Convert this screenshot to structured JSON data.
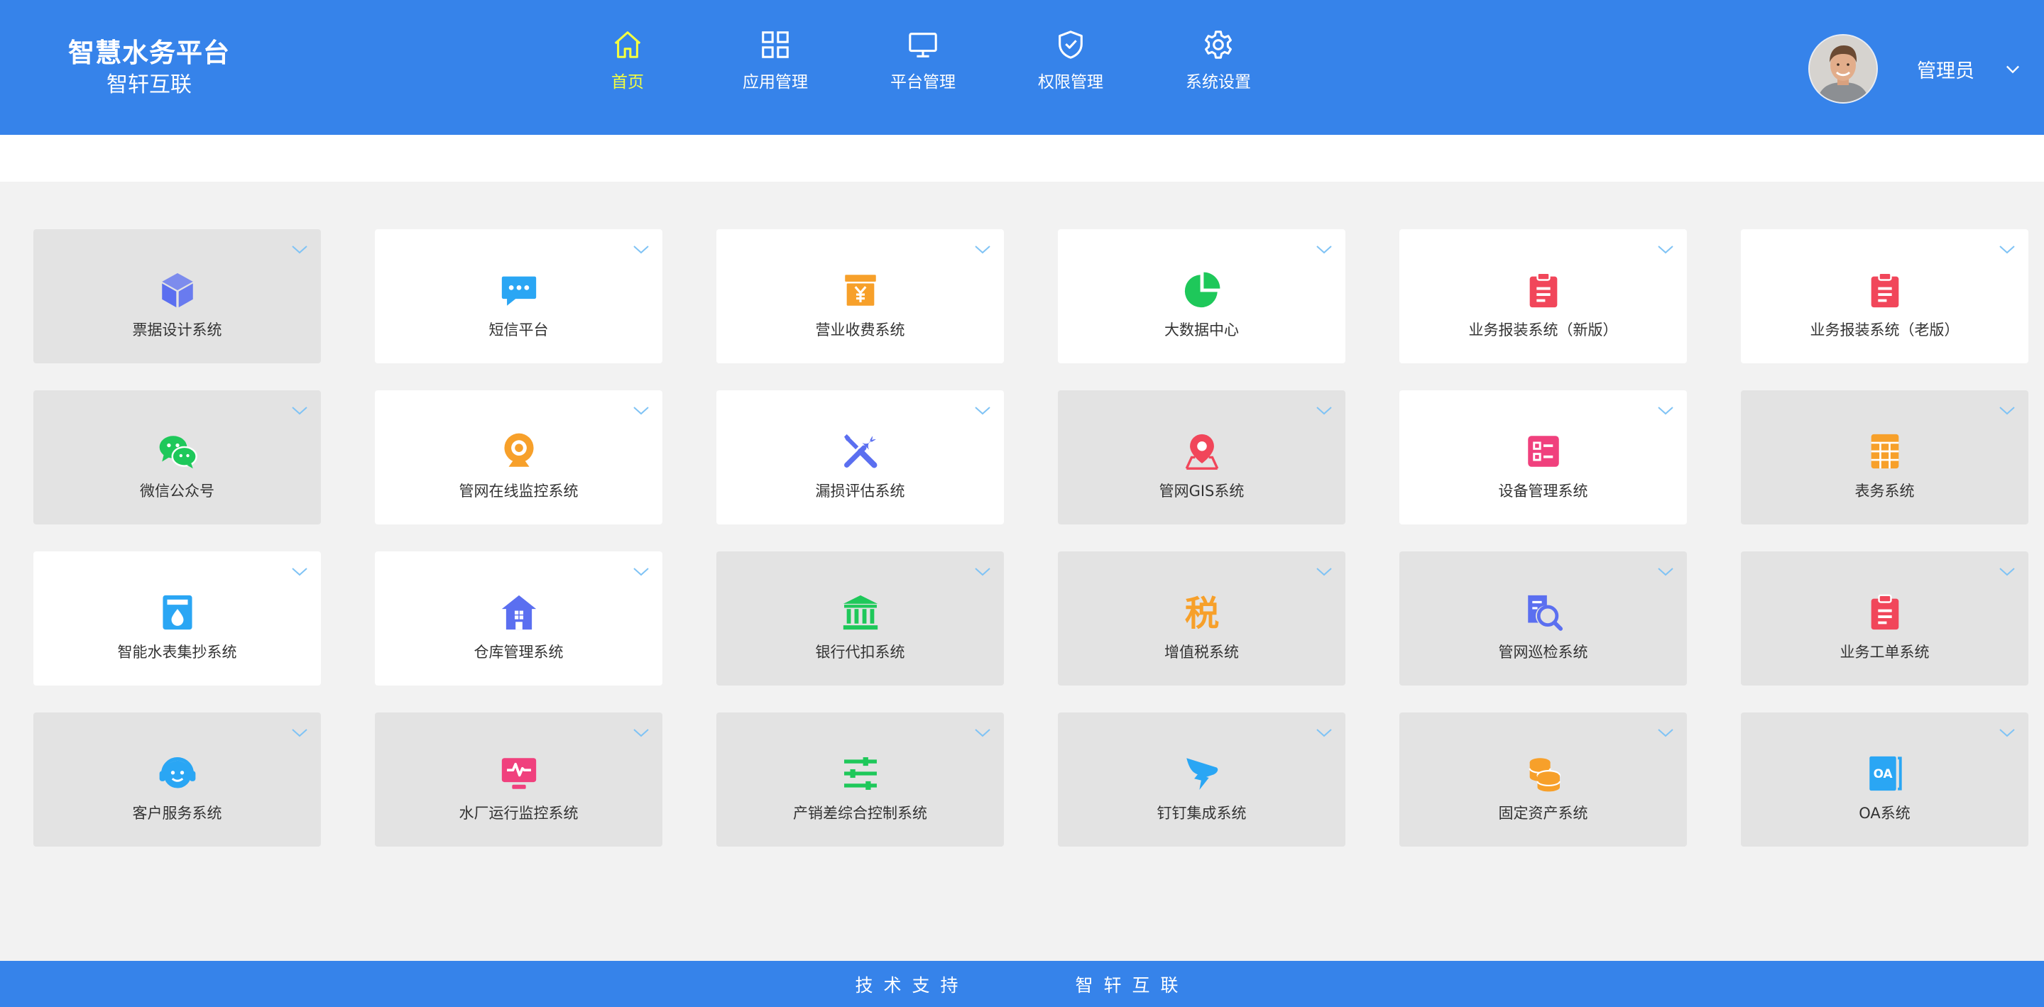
{
  "brand": {
    "title": "智慧水务平台",
    "subtitle": "智轩互联"
  },
  "nav": [
    {
      "label": "首页",
      "icon": "home-icon",
      "active": true
    },
    {
      "label": "应用管理",
      "icon": "grid-icon",
      "active": false
    },
    {
      "label": "平台管理",
      "icon": "monitor-icon",
      "active": false
    },
    {
      "label": "权限管理",
      "icon": "shield-check-icon",
      "active": false
    },
    {
      "label": "系统设置",
      "icon": "gear-icon",
      "active": false
    }
  ],
  "user": {
    "name": "管理员"
  },
  "apps": [
    {
      "label": "票据设计系统",
      "icon": "cube-icon",
      "color": "#5b6ff0",
      "bg": "grey"
    },
    {
      "label": "短信平台",
      "icon": "chat-bubble-icon",
      "color": "#2aa6f4",
      "bg": "white"
    },
    {
      "label": "营业收费系统",
      "icon": "yuan-box-icon",
      "color": "#f7a02a",
      "bg": "white"
    },
    {
      "label": "大数据中心",
      "icon": "pie-chart-icon",
      "color": "#1ec85a",
      "bg": "white"
    },
    {
      "label": "业务报装系统（新版）",
      "icon": "clipboard-icon",
      "color": "#f1465a",
      "bg": "white"
    },
    {
      "label": "业务报装系统（老版）",
      "icon": "clipboard-icon",
      "color": "#f1465a",
      "bg": "white"
    },
    {
      "label": "微信公众号",
      "icon": "wechat-icon",
      "color": "#1ec85a",
      "bg": "grey"
    },
    {
      "label": "管网在线监控系统",
      "icon": "webcam-icon",
      "color": "#f7a02a",
      "bg": "white"
    },
    {
      "label": "漏损评估系统",
      "icon": "tools-icon",
      "color": "#5b6ff0",
      "bg": "white"
    },
    {
      "label": "管网GIS系统",
      "icon": "map-pin-icon",
      "color": "#f1465a",
      "bg": "grey"
    },
    {
      "label": "设备管理系统",
      "icon": "device-list-icon",
      "color": "#f0407d",
      "bg": "white"
    },
    {
      "label": "表务系统",
      "icon": "calculator-icon",
      "color": "#f7a02a",
      "bg": "grey"
    },
    {
      "label": "智能水表集抄系统",
      "icon": "water-meter-icon",
      "color": "#2aa6f4",
      "bg": "white"
    },
    {
      "label": "仓库管理系统",
      "icon": "warehouse-icon",
      "color": "#5b6ff0",
      "bg": "white"
    },
    {
      "label": "银行代扣系统",
      "icon": "bank-icon",
      "color": "#1ec85a",
      "bg": "grey"
    },
    {
      "label": "增值税系统",
      "icon": "tax-icon",
      "color": "#f7a02a",
      "bg": "grey",
      "glyph": "税"
    },
    {
      "label": "管网巡检系统",
      "icon": "inspect-icon",
      "color": "#5b6ff0",
      "bg": "grey"
    },
    {
      "label": "业务工单系统",
      "icon": "clipboard-icon",
      "color": "#f1465a",
      "bg": "grey"
    },
    {
      "label": "客户服务系统",
      "icon": "headset-icon",
      "color": "#2aa6f4",
      "bg": "grey"
    },
    {
      "label": "水厂运行监控系统",
      "icon": "pulse-monitor-icon",
      "color": "#f0407d",
      "bg": "grey"
    },
    {
      "label": "产销差综合控制系统",
      "icon": "sliders-icon",
      "color": "#1ec85a",
      "bg": "grey"
    },
    {
      "label": "钉钉集成系统",
      "icon": "dingtalk-icon",
      "color": "#2aa6f4",
      "bg": "grey"
    },
    {
      "label": "固定资产系统",
      "icon": "coins-icon",
      "color": "#f7a02a",
      "bg": "grey"
    },
    {
      "label": "OA系统",
      "icon": "oa-book-icon",
      "color": "#2aa6f4",
      "bg": "grey",
      "glyph": "OA"
    }
  ],
  "footer": {
    "left": "技术支持",
    "right": "智轩互联"
  },
  "colors": {
    "primary": "#3683ea",
    "active_nav": "#f4ff3f",
    "card_grey": "#e3e3e3",
    "card_white": "#ffffff",
    "chevron": "#7fc3f5"
  }
}
